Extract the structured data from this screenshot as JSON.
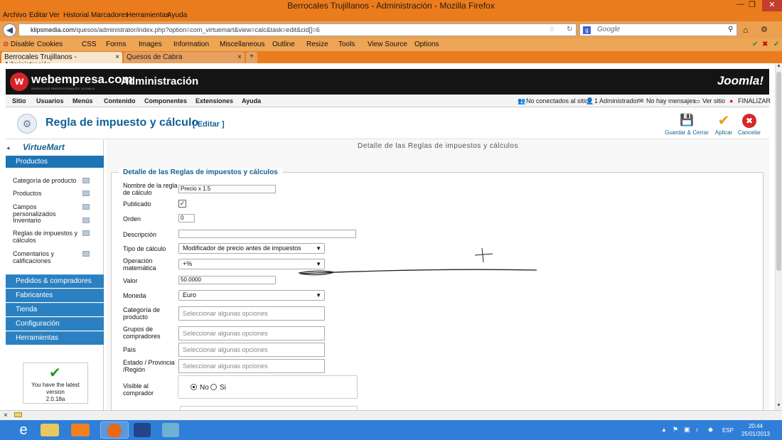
{
  "window": {
    "title": "Berrocales Trujillanos - Administración - Mozilla Firefox"
  },
  "menubar": [
    "Archivo",
    "Editar",
    "Ver",
    "Historial",
    "Marcadores",
    "Herramientas",
    "Ayuda"
  ],
  "navbar": {
    "url_host": "klipsmedia.com",
    "url_path": "/quesos/administrator/index.php?option=com_virtuemart&view=calc&task=edit&cid[]=6",
    "search_placeholder": "Google"
  },
  "webdev_toolbar": [
    "Disable",
    "Cookies",
    "CSS",
    "Forms",
    "Images",
    "Information",
    "Miscellaneous",
    "Outline",
    "Resize",
    "Tools",
    "View Source",
    "Options"
  ],
  "tabs": [
    {
      "label": "Berrocales Trujillanos - Administración",
      "active": true
    },
    {
      "label": "Quesos de Cabra",
      "active": false
    }
  ],
  "header": {
    "brand": "webempresa.com",
    "brand_sub": "SERVICIOS PROFESIONALES JOOMLA",
    "admin_title": "Administración",
    "joomla_logo": "Joomla!"
  },
  "top_menu": {
    "items": [
      "Sitio",
      "Usuarios",
      "Menús",
      "Contenido",
      "Componentes",
      "Extensiones",
      "Ayuda"
    ],
    "status": [
      "No conectados al sitio",
      "1 Administrador",
      "No hay mensajes",
      "Ver sitio",
      "FINALIZAR"
    ]
  },
  "toolbar": {
    "page_title": "Regla de impuesto y cálculo",
    "edit_tag": "[ Editar ]",
    "buttons": [
      {
        "label": "Guardar & Cerrar",
        "icon": "save-icon"
      },
      {
        "label": "Aplicar",
        "icon": "check-icon"
      },
      {
        "label": "Cancelar",
        "icon": "cancel-icon"
      }
    ]
  },
  "sidebar": {
    "logo": "VirtueMart",
    "section": "Productos",
    "items": [
      "Categoría de producto",
      "Productos",
      "Campos personalizados",
      "Inventario",
      "Reglas de impuestos y cálculos",
      "Comentarios y calificaciones"
    ],
    "categories": [
      "Pedidos & compradores",
      "Fabricantes",
      "Tienda",
      "Configuración",
      "Herramientas"
    ],
    "version_box": [
      "You have the latest",
      "version",
      "2.0.18a"
    ]
  },
  "main": {
    "heading": "Detalle de las Reglas de impuestos y cálculos",
    "legend": "Detalle de las Reglas de impuestos y cálculos",
    "fields": {
      "name_label": "Nombre de la regla de cálculo",
      "name_value": "Precio x 1.5",
      "published_label": "Publicado",
      "order_label": "Orden",
      "order_value": "0",
      "description_label": "Descripción",
      "description_value": "",
      "calc_type_label": "Tipo de cálculo",
      "calc_type_value": "Modificador de precio antes de impuestos",
      "operation_label": "Operación matemática",
      "operation_value": "+%",
      "value_label": "Valor",
      "value_value": "50.0000",
      "currency_label": "Moneda",
      "currency_value": "Euro",
      "category_label": "Categoría de producto",
      "groups_label": "Grupos de compradores",
      "country_label": "País",
      "state_label": "Estado / Provincia /Región",
      "multi_placeholder": "Seleccionar algunas opciones",
      "visible_label": "Visible al comprador",
      "visible_no": "No",
      "visible_yes": "Si"
    }
  },
  "clock": {
    "time": "20:44",
    "date": "25/01/2013",
    "lang": "ESP"
  }
}
